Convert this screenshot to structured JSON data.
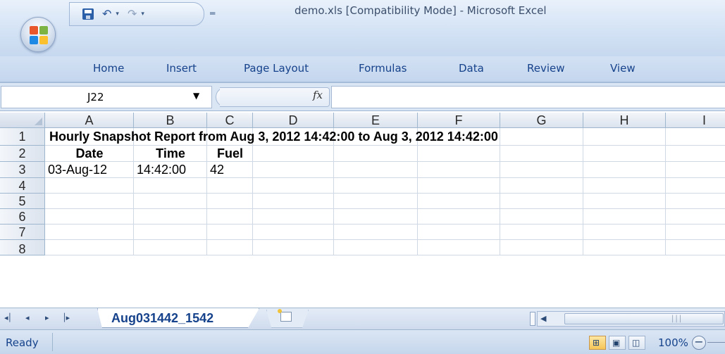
{
  "window": {
    "title": "demo.xls  [Compatibility Mode]  -  Microsoft Excel"
  },
  "quick_access": {
    "save_icon": "save-icon",
    "undo_icon": "undo-icon",
    "redo_icon": "redo-icon",
    "customize_glyph": "═"
  },
  "ribbon": {
    "tabs": [
      "Home",
      "Insert",
      "Page Layout",
      "Formulas",
      "Data",
      "Review",
      "View"
    ]
  },
  "formula_bar": {
    "name_box": "J22",
    "fx_label": "fx",
    "formula": ""
  },
  "sheet": {
    "columns": [
      "A",
      "B",
      "C",
      "D",
      "E",
      "F",
      "G",
      "H",
      "I"
    ],
    "rows": [
      "1",
      "2",
      "3",
      "4",
      "5",
      "6",
      "7",
      "8"
    ],
    "cells": {
      "A1": "Hourly Snapshot Report from Aug 3, 2012 14:42:00 to Aug 3, 2012 14:42:00",
      "A2": "Date",
      "B2": "Time",
      "C2": "Fuel",
      "A3": "03-Aug-12",
      "B3": "14:42:00",
      "C3": "42"
    }
  },
  "sheet_tabs": {
    "nav": [
      "◂│",
      "◂",
      "▸",
      "│▸"
    ],
    "active_tab": "Aug031442_1542"
  },
  "status_bar": {
    "status": "Ready",
    "zoom": "100%",
    "zoom_out": "−"
  }
}
